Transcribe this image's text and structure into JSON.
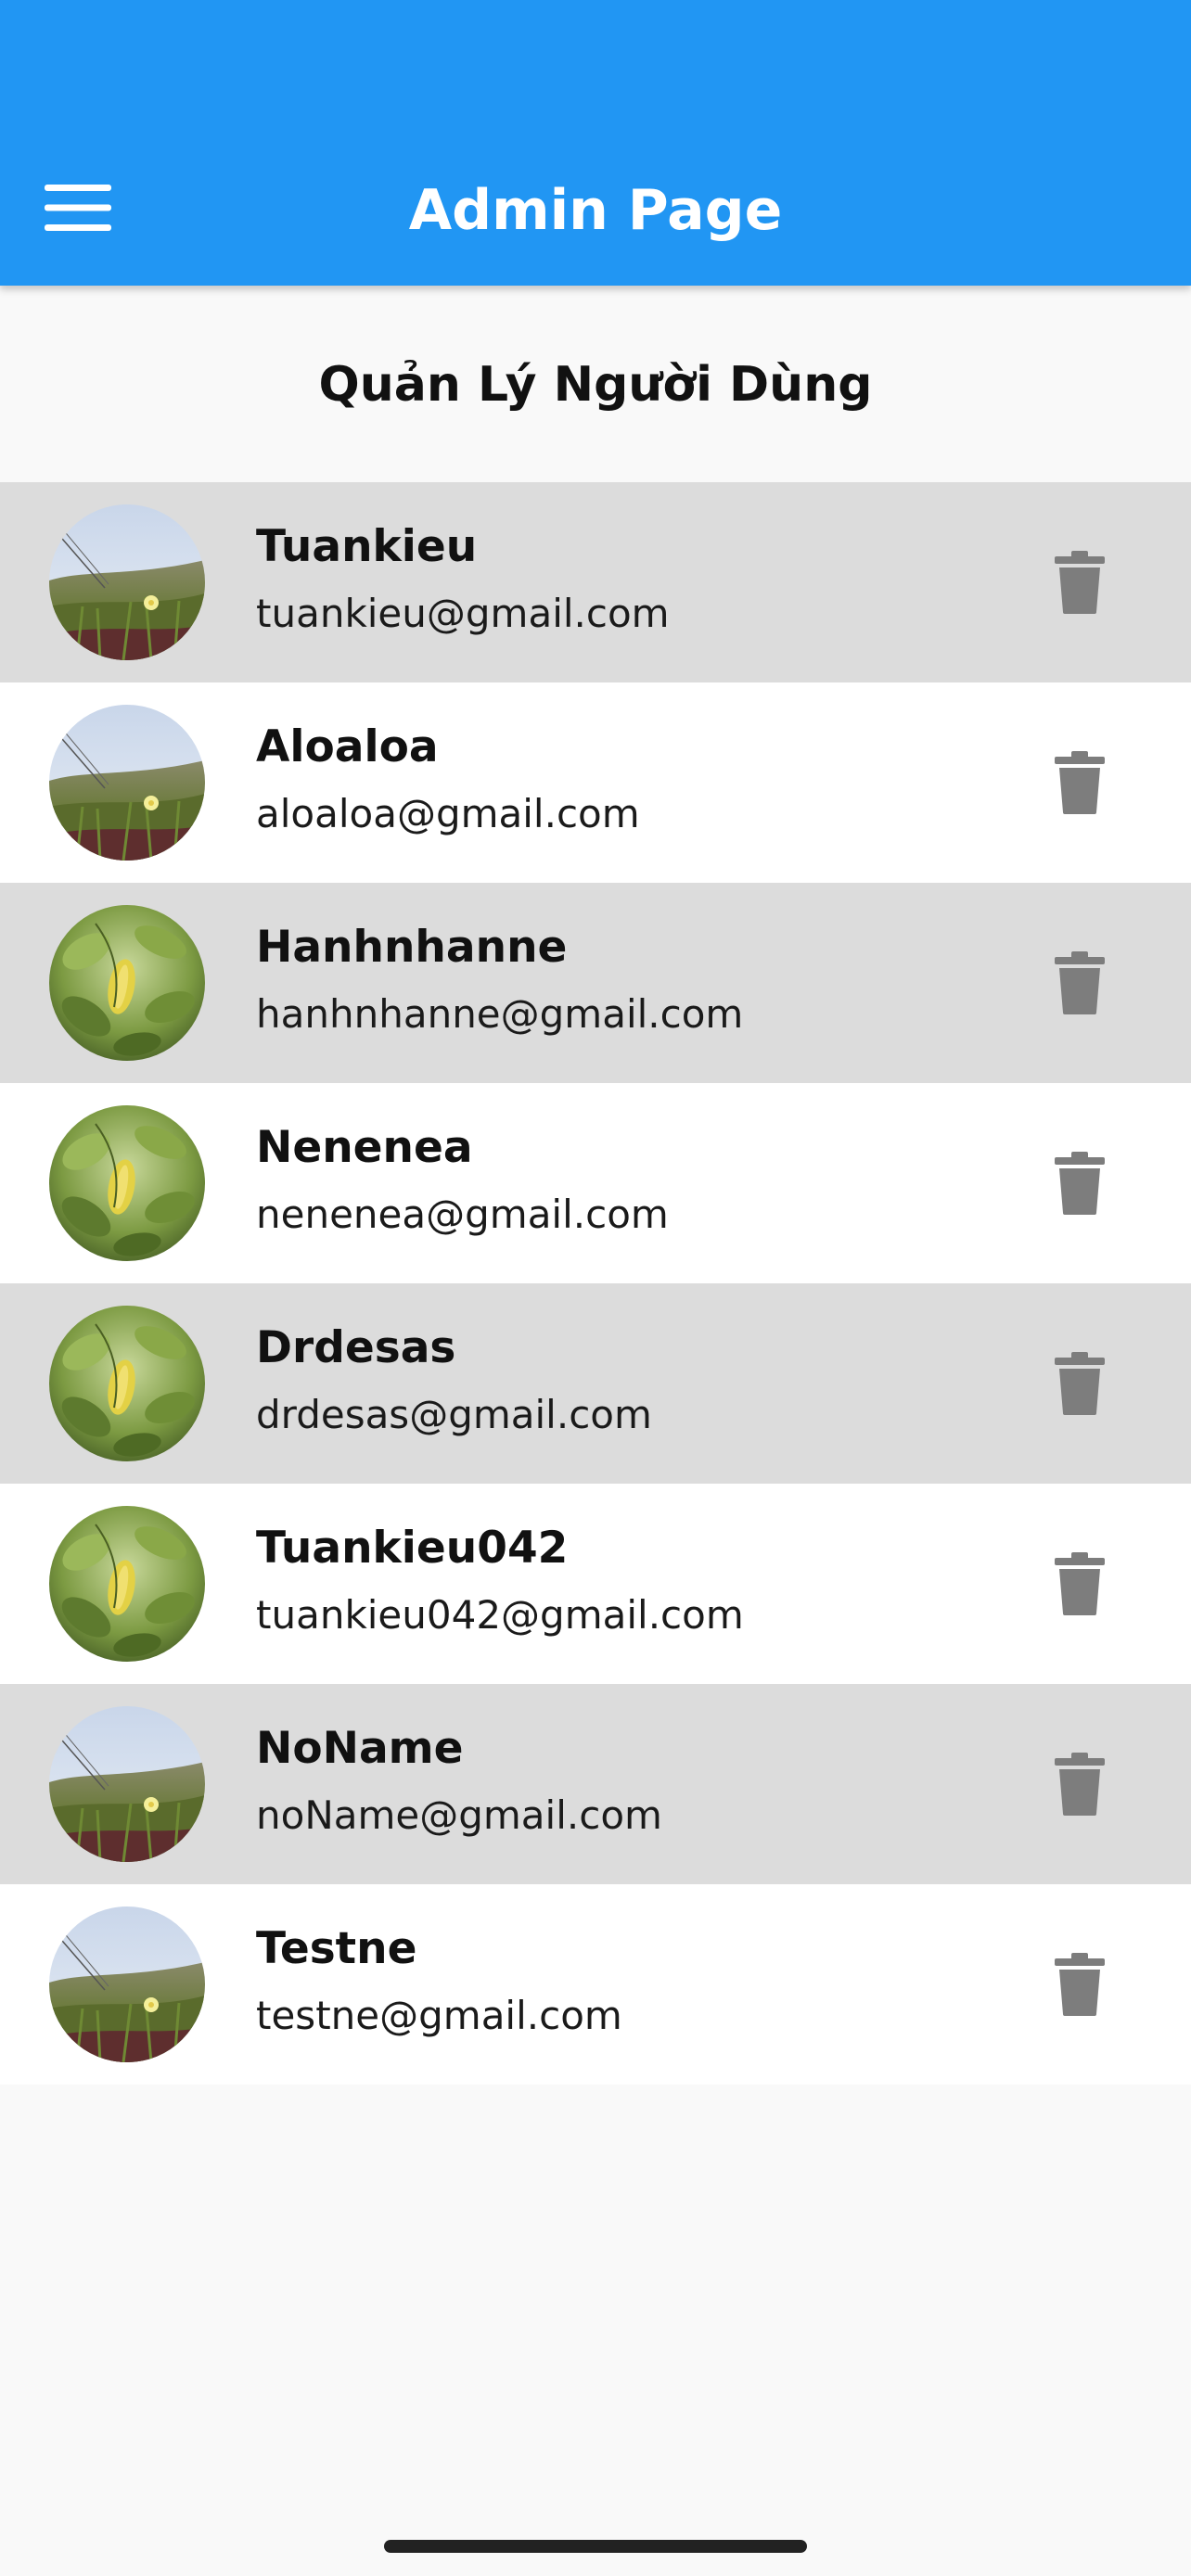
{
  "app_bar": {
    "title": "Admin Page",
    "menu_icon": "menu-icon",
    "color": "#2196f3"
  },
  "page": {
    "heading": "Quản Lý Người Dùng"
  },
  "users": [
    {
      "name": "Tuankieu",
      "email": "tuankieu@gmail.com",
      "avatar": "grass-photo"
    },
    {
      "name": "Aloaloa",
      "email": "aloaloa@gmail.com",
      "avatar": "grass-photo"
    },
    {
      "name": "Hanhnhanne",
      "email": "hanhnhanne@gmail.com",
      "avatar": "leaf-photo"
    },
    {
      "name": "Nenenea",
      "email": "nenenea@gmail.com",
      "avatar": "leaf-photo"
    },
    {
      "name": "Drdesas",
      "email": "drdesas@gmail.com",
      "avatar": "leaf-photo"
    },
    {
      "name": "Tuankieu042",
      "email": "tuankieu042@gmail.com",
      "avatar": "leaf-photo"
    },
    {
      "name": "NoName",
      "email": "noName@gmail.com",
      "avatar": "grass-photo"
    },
    {
      "name": "Testne",
      "email": "testne@gmail.com",
      "avatar": "grass-photo"
    }
  ],
  "row_colors": {
    "shaded": "#dcdcdc",
    "plain": "#ffffff"
  },
  "delete_icon": "trash-icon"
}
